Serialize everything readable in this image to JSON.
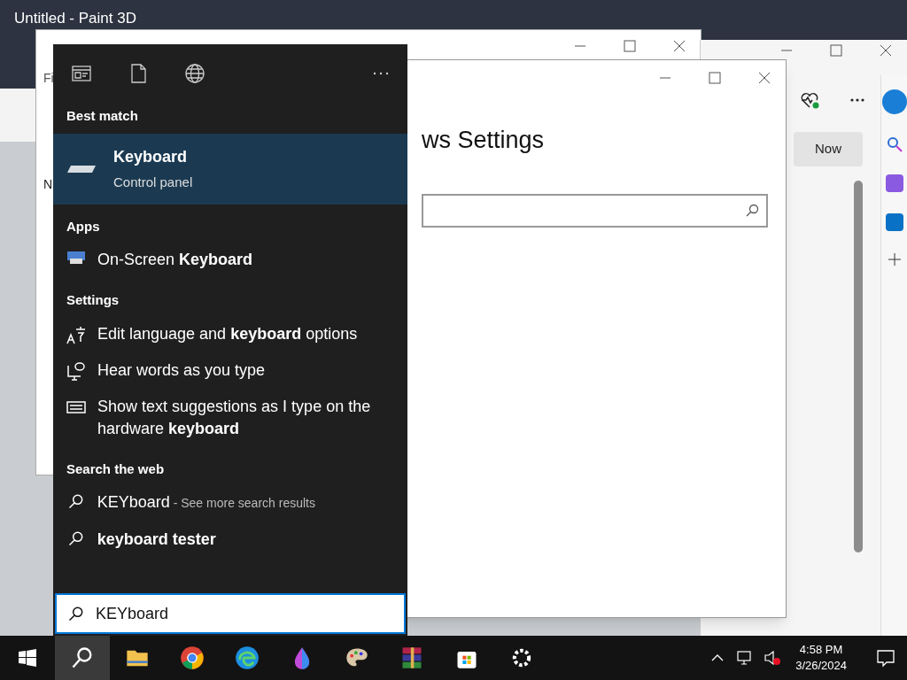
{
  "paint_window": {
    "title": "Untitled - Paint 3D"
  },
  "explorer_window": {
    "menu_text": "Fi",
    "column_text": "N"
  },
  "settings_window": {
    "heading": "ws Settings"
  },
  "browser_window": {
    "button": "Now"
  },
  "start_menu": {
    "best_match": {
      "header": "Best match",
      "title": "Keyboard",
      "subtitle": "Control panel",
      "selected": true
    },
    "sections": [
      {
        "header": "Apps",
        "items": [
          {
            "kind": "onscreen",
            "text": "On-Screen **Keyboard**"
          }
        ]
      },
      {
        "header": "Settings",
        "items": [
          {
            "kind": "language",
            "text": "Edit language and **keyboard** options"
          },
          {
            "kind": "speech",
            "text": "Hear words as you type"
          },
          {
            "kind": "keyboard",
            "text": "Show text suggestions as I type on the hardware **keyboard**"
          }
        ]
      },
      {
        "header": "Search the web",
        "items": [
          {
            "kind": "web",
            "text": "KEYboard",
            "hint": "- See more search results"
          },
          {
            "kind": "web",
            "text": "**keyboard tester**"
          }
        ]
      }
    ],
    "search": {
      "value": "KEYboard"
    }
  },
  "taskbar": {
    "items": [
      {
        "kind": "start",
        "selected": false
      },
      {
        "kind": "search",
        "selected": true
      },
      {
        "kind": "folder",
        "selected": false
      },
      {
        "kind": "chrome",
        "selected": false
      },
      {
        "kind": "edge",
        "selected": false
      },
      {
        "kind": "drop",
        "selected": false
      },
      {
        "kind": "palette",
        "selected": false
      },
      {
        "kind": "archive",
        "selected": false
      },
      {
        "kind": "store",
        "selected": false
      },
      {
        "kind": "gear",
        "selected": false
      }
    ],
    "time": "4:58 PM",
    "date": "3/26/2024"
  }
}
